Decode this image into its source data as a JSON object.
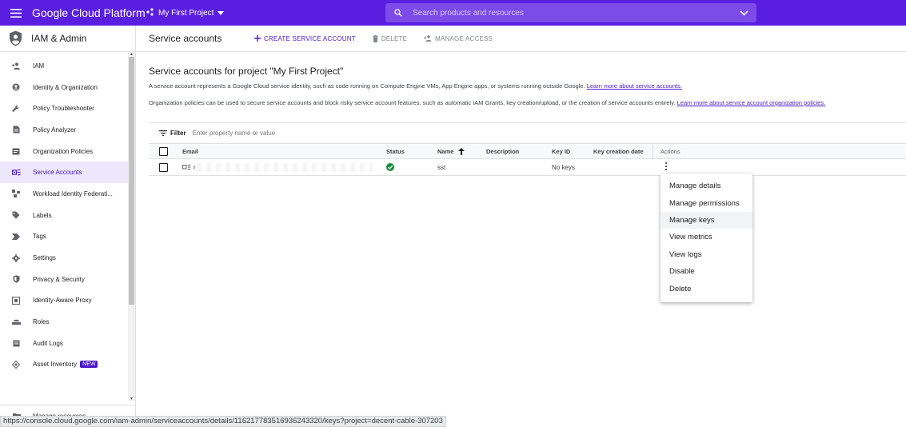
{
  "topbar": {
    "brand": "Google Cloud Platform",
    "project": "My First Project",
    "search_placeholder": "Search products and resources",
    "color": "#5a1ee0"
  },
  "sidebar": {
    "title": "IAM & Admin",
    "items": [
      {
        "label": "IAM",
        "icon": "person-add-icon"
      },
      {
        "label": "Identity & Organization",
        "icon": "account-circle-icon"
      },
      {
        "label": "Policy Troubleshooter",
        "icon": "wrench-icon"
      },
      {
        "label": "Policy Analyzer",
        "icon": "document-icon"
      },
      {
        "label": "Organization Policies",
        "icon": "list-box-icon"
      },
      {
        "label": "Service Accounts",
        "icon": "service-account-icon",
        "active": true
      },
      {
        "label": "Workload Identity Federati...",
        "icon": "federation-icon"
      },
      {
        "label": "Labels",
        "icon": "label-icon"
      },
      {
        "label": "Tags",
        "icon": "tag-arrow-icon"
      },
      {
        "label": "Settings",
        "icon": "gear-icon"
      },
      {
        "label": "Privacy & Security",
        "icon": "shield-icon"
      },
      {
        "label": "Identity-Aware Proxy",
        "icon": "proxy-icon"
      },
      {
        "label": "Roles",
        "icon": "roles-icon"
      },
      {
        "label": "Audit Logs",
        "icon": "logs-icon"
      },
      {
        "label": "Asset Inventory",
        "icon": "asset-icon",
        "badge": "NEW"
      }
    ],
    "manage_resources": "Manage resources"
  },
  "toolbar": {
    "page_title": "Service accounts",
    "create_label": "CREATE SERVICE ACCOUNT",
    "delete_label": "DELETE",
    "manage_access_label": "MANAGE ACCESS"
  },
  "content": {
    "heading": "Service accounts for project \"My First Project\"",
    "desc1": "A service account represents a Google Cloud service identity, such as code running on Compute Engine VMs, App Engine apps, or systems running outside Google.",
    "desc1_link": "Learn more about service accounts.",
    "desc2": "Organization policies can be used to secure service accounts and block risky service account features, such as automatic IAM Grants, key creation/upload, or the creation of service accounts entirely.",
    "desc2_link": "Learn more about service account organization policies."
  },
  "filter": {
    "label": "Filter",
    "placeholder": "Enter property name or value"
  },
  "table": {
    "headers": {
      "email": "Email",
      "status": "Status",
      "name": "Name",
      "description": "Description",
      "key_id": "Key ID",
      "key_creation_date": "Key creation date",
      "actions": "Actions"
    },
    "rows": [
      {
        "email_prefix": "r",
        "status": "enabled",
        "name": "sst",
        "description": "",
        "key_id": "No keys",
        "key_creation_date": ""
      }
    ]
  },
  "menu": {
    "items": [
      "Manage details",
      "Manage permissions",
      "Manage keys",
      "View metrics",
      "View logs",
      "Disable",
      "Delete"
    ],
    "hovered": "Manage keys"
  },
  "status_url": "https://console.cloud.google.com/iam-admin/serviceaccounts/details/116217783516936243320/keys?project=decent-cable-307203"
}
